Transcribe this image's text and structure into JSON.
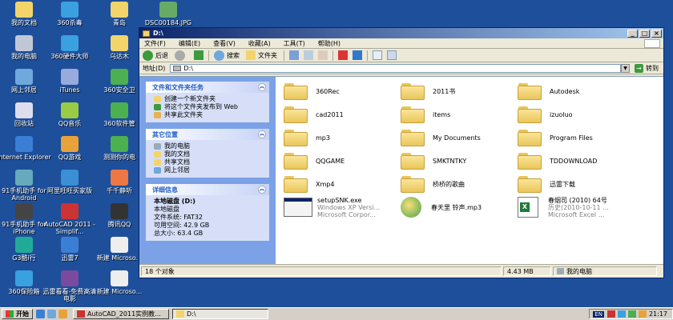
{
  "desktop_icons": [
    {
      "label": "我的文档",
      "color": "#f2d46b",
      "icon": "my-documents-icon"
    },
    {
      "label": "360杀毒",
      "color": "#3aa0e0",
      "icon": "antivirus-icon"
    },
    {
      "label": "青岛",
      "color": "#f2d46b",
      "icon": "folder-icon"
    },
    {
      "label": "DSC00184.JPG",
      "color": "#66aa66",
      "icon": "image-file-icon"
    },
    {
      "label": "我的电脑",
      "color": "#c0c8d8",
      "icon": "my-computer-icon"
    },
    {
      "label": "360硬件大师",
      "color": "#3aa0e0",
      "icon": "hardware-master-icon"
    },
    {
      "label": "乌达木",
      "color": "#f2d46b",
      "icon": "folder-icon"
    },
    {
      "label": "网上邻居",
      "color": "#6fa8dc",
      "icon": "network-icon"
    },
    {
      "label": "iTunes",
      "color": "#9ad",
      "icon": "itunes-icon"
    },
    {
      "label": "360安全卫",
      "color": "#4caf50",
      "icon": "security-guard-icon"
    },
    {
      "label": "回收站",
      "color": "#dde",
      "icon": "recycle-bin-icon"
    },
    {
      "label": "QQ音乐",
      "color": "#9c4",
      "icon": "qq-music-icon"
    },
    {
      "label": "360软件管",
      "color": "#4caf50",
      "icon": "software-manager-icon"
    },
    {
      "label": "Internet Explorer",
      "color": "#3a7fd5",
      "icon": "internet-explorer-icon"
    },
    {
      "label": "QQ游戏",
      "color": "#e8a23a",
      "icon": "qq-game-icon"
    },
    {
      "label": "测测你的电",
      "color": "#4caf50",
      "icon": "pc-test-icon"
    },
    {
      "label": "91手机助手 for Android",
      "color": "#6ab",
      "icon": "phone-assistant-android-icon"
    },
    {
      "label": "阿里旺旺买家版",
      "color": "#3a8fd5",
      "icon": "aliwangwang-icon"
    },
    {
      "label": "千千静听",
      "color": "#e74",
      "icon": "ttplayer-icon"
    },
    {
      "label": "91手机助手 for iPhone",
      "color": "#444",
      "icon": "phone-assistant-iphone-icon"
    },
    {
      "label": "AutoCAD 2011 - Simplif...",
      "color": "#c33",
      "icon": "autocad-icon"
    },
    {
      "label": "腾讯QQ",
      "color": "#333",
      "icon": "qq-icon"
    },
    {
      "label": "G3酷i行",
      "color": "#2a9",
      "icon": "g3-icon"
    },
    {
      "label": "迅雷7",
      "color": "#3a7fd5",
      "icon": "thunder-icon"
    },
    {
      "label": "新建 Microso...",
      "color": "#eee",
      "icon": "word-doc-icon"
    },
    {
      "label": "360保险箱",
      "color": "#3aa0e0",
      "icon": "safe-box-icon"
    },
    {
      "label": "迅雷看看-免费高清电影",
      "color": "#7a4aa0",
      "icon": "thunder-player-icon"
    },
    {
      "label": "新建 Microso...",
      "color": "#eee",
      "icon": "excel-doc-icon"
    }
  ],
  "window": {
    "title": "D:\\",
    "menu": [
      "文件(F)",
      "编辑(E)",
      "查看(V)",
      "收藏(A)",
      "工具(T)",
      "帮助(H)"
    ],
    "toolbar": {
      "back": "后退",
      "search": "搜索",
      "folders": "文件夹"
    },
    "address": {
      "label": "地址(D)",
      "value": "D:\\",
      "go": "转到"
    },
    "tasks_panel": {
      "title": "文件和文件夹任务",
      "items": [
        "创建一个新文件夹",
        "将这个文件夹发布到 Web",
        "共享此文件夹"
      ]
    },
    "places_panel": {
      "title": "其它位置",
      "items": [
        "我的电脑",
        "我的文档",
        "共享文档",
        "网上邻居"
      ]
    },
    "details_panel": {
      "title": "详细信息",
      "name": "本地磁盘 (D:)",
      "type": "本地磁盘",
      "fs": "文件系统: FAT32",
      "free": "可用空间: 42.9 GB",
      "total": "总大小: 63.4 GB"
    },
    "files": [
      {
        "name": "360Rec",
        "kind": "folder"
      },
      {
        "name": "2011书",
        "kind": "folder"
      },
      {
        "name": "Autodesk",
        "kind": "folder"
      },
      {
        "name": "cad2011",
        "kind": "folder"
      },
      {
        "name": "items",
        "kind": "folder"
      },
      {
        "name": "izuoluo",
        "kind": "folder"
      },
      {
        "name": "mp3",
        "kind": "folder"
      },
      {
        "name": "My Documents",
        "kind": "folder"
      },
      {
        "name": "Program Files",
        "kind": "folder"
      },
      {
        "name": "QQGAME",
        "kind": "folder"
      },
      {
        "name": "SMKTNTKY",
        "kind": "folder"
      },
      {
        "name": "TDDOWNLOAD",
        "kind": "folder"
      },
      {
        "name": "Xmp4",
        "kind": "folder"
      },
      {
        "name": "桥桥的歌曲",
        "kind": "folder"
      },
      {
        "name": "迅雷下载",
        "kind": "folder"
      },
      {
        "name": "setupSNK.exe",
        "sub1": "Windows XP Versi...",
        "sub2": "Microsoft Corpor...",
        "kind": "exe"
      },
      {
        "name": "春天里 铃声.mp3",
        "kind": "mp3"
      },
      {
        "name": "春烟司 (2010) 64号",
        "sub1": "历史(2010-10-11 ...",
        "sub2": "Microsoft Excel ...",
        "kind": "xls"
      }
    ],
    "status": {
      "count": "18 个对象",
      "size": "4.43 MB",
      "location": "我的电脑"
    }
  },
  "taskbar": {
    "start": "开始",
    "tasks": [
      {
        "label": "AutoCAD_2011实例教...",
        "active": false
      },
      {
        "label": "D:\\",
        "active": true
      }
    ],
    "lang": "EN",
    "time": "21:17"
  }
}
